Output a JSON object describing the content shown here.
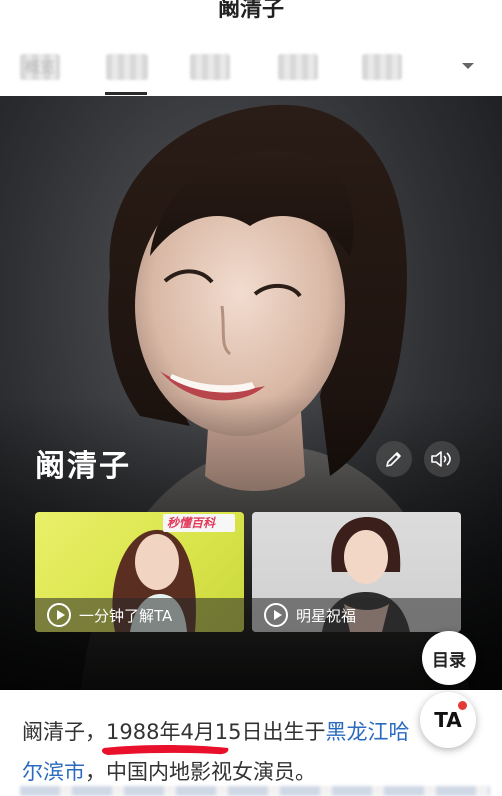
{
  "header": {
    "title": "阚清子"
  },
  "tabs": {
    "items": [
      {
        "label": "概览",
        "active": false
      },
      {
        "label": "",
        "active": true
      },
      {
        "label": "",
        "active": false
      },
      {
        "label": "",
        "active": false
      },
      {
        "label": "",
        "active": false
      }
    ],
    "dropdown_icon": "chevron-down-icon"
  },
  "hero": {
    "name": "阚清子",
    "edit_icon": "pencil-icon",
    "audio_icon": "speaker-icon"
  },
  "videos": [
    {
      "label": "一分钟了解TA",
      "badge": "秒懂百科",
      "play_icon": "play-icon"
    },
    {
      "label": "明星祝福",
      "play_icon": "play-icon"
    }
  ],
  "toc_button": {
    "label": "目录"
  },
  "ta_button": {
    "label": "TA"
  },
  "article": {
    "intro_name": "阚清子，",
    "birth": "1988年4月15日",
    "born_in": "出生于",
    "place_link1": "黑龙江",
    "place_link2": "哈",
    "place_link3": "尔滨市",
    "rest": "，中国内地影视女演员。"
  },
  "colors": {
    "link": "#2a6bbf",
    "underline_mark": "#e8102a",
    "ta_dot": "#e53935"
  }
}
